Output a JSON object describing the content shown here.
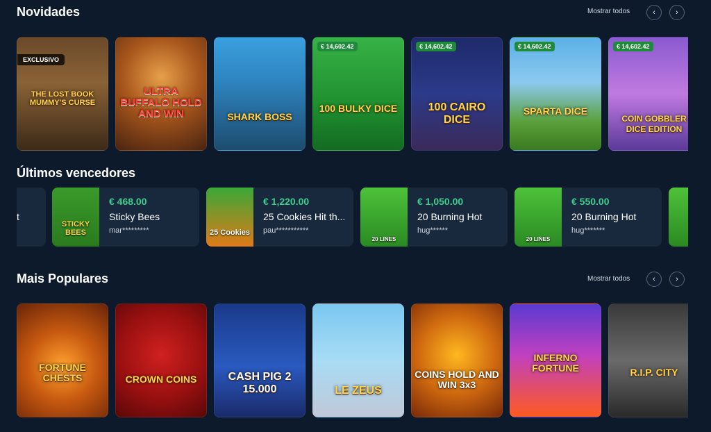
{
  "sections": {
    "new": {
      "title": "Novidades",
      "show_all": "Mostrar todos"
    },
    "winners": {
      "title": "Últimos vencedores"
    },
    "popular": {
      "title": "Mais Populares",
      "show_all": "Mostrar todos"
    }
  },
  "nav": {
    "prev_icon": "‹",
    "next_icon": "›"
  },
  "new_games": [
    {
      "name": "THE LOST BOOK MUMMY'S CURSE",
      "badge": "EXCLUSIVO"
    },
    {
      "name": "ULTRA BUFFALO HOLD AND WIN"
    },
    {
      "name": "SHARK BOSS"
    },
    {
      "name": "100 BULKY DICE",
      "jackpot": "€ 14,602.42"
    },
    {
      "name": "100 CAIRO DICE",
      "jackpot": "€ 14,602.42"
    },
    {
      "name": "SPARTA DICE",
      "jackpot": "€ 14,602.42"
    },
    {
      "name": "COIN GOBBLER DICE EDITION",
      "jackpot": "€ 14,602.42"
    }
  ],
  "winners": [
    {
      "amount": "€ 468.00",
      "game": "Sticky Bees",
      "user": "mar*********",
      "thumb_label": "STICKY BEES"
    },
    {
      "amount": "€ 1,220.00",
      "game": "25 Cookies Hit th...",
      "user": "pau***********",
      "thumb_label": "25 Cookies"
    },
    {
      "amount": "€ 1,050.00",
      "game": "20 Burning Hot",
      "user": "hug******",
      "thumb_label": "20 LINES"
    },
    {
      "amount": "€ 550.00",
      "game": "20 Burning Hot",
      "user": "hug*******",
      "thumb_label": "20 LINES"
    }
  ],
  "winners_partial_left_text": "t",
  "popular_games": [
    {
      "name": "FORTUNE CHESTS"
    },
    {
      "name": "CROWN COINS"
    },
    {
      "name": "CASH PIG 2 15.000"
    },
    {
      "name": "LE ZEUS"
    },
    {
      "name": "COINS HOLD AND WIN 3x3"
    },
    {
      "name": "INFERNO FORTUNE"
    },
    {
      "name": "R.I.P. CITY"
    }
  ],
  "colors": {
    "background": "#0c1a2b",
    "card_bg": "#18293d",
    "amount_green": "#3ecf8e",
    "jackpot_badge": "#1f8a3c"
  }
}
